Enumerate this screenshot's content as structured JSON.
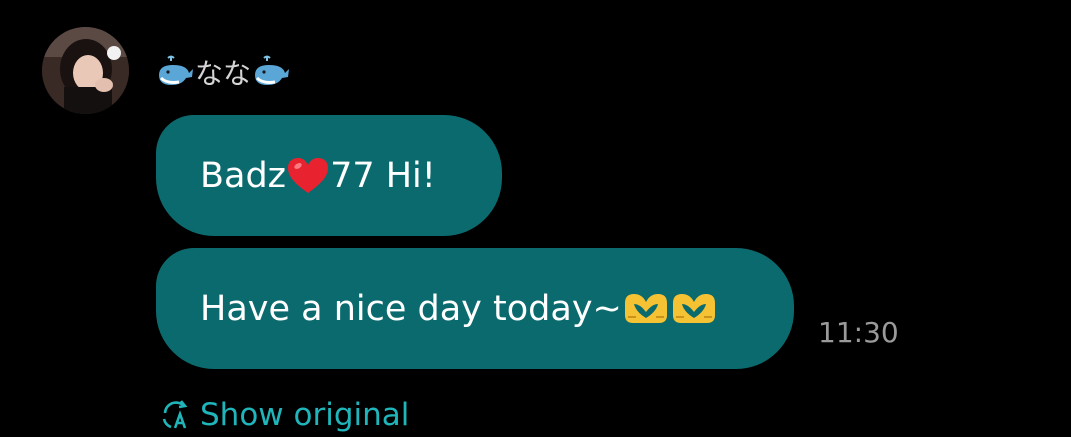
{
  "sender": {
    "name": "なな",
    "left_icon": "whale-icon",
    "right_icon": "whale-icon",
    "avatar": "user-avatar-photo"
  },
  "messages": [
    {
      "prefix": "Badz",
      "icon": "red-heart-icon",
      "suffix": "77 Hi!"
    },
    {
      "text": "Have a nice day today~",
      "icons": [
        "heart-hands-icon",
        "heart-hands-icon"
      ]
    }
  ],
  "timestamp": "11:30",
  "show_original": {
    "label": "Show original",
    "icon": "translate-icon"
  },
  "colors": {
    "background": "#000000",
    "bubble": "#0b6a6e",
    "link": "#1fb5ba",
    "timestamp": "#9a9a9a"
  }
}
